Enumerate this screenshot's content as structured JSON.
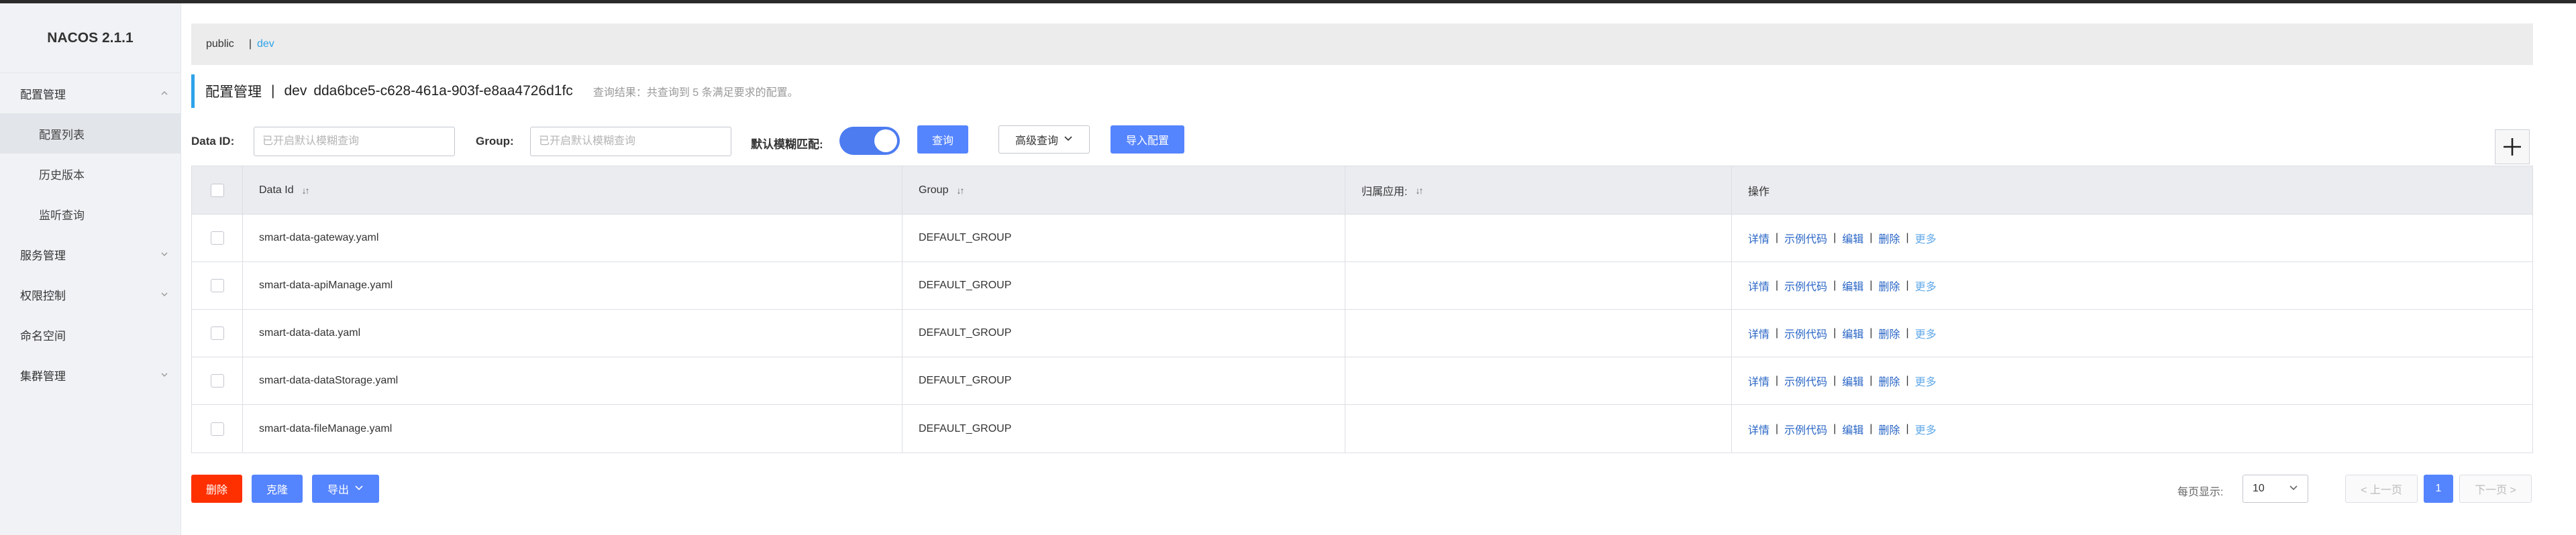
{
  "app": {
    "title": "NACOS 2.1.1"
  },
  "sidebar": {
    "items": [
      {
        "label": "配置管理",
        "expanded": true,
        "icon": "chevron-up-icon"
      },
      {
        "label": "配置列表",
        "sub": true,
        "active": true
      },
      {
        "label": "历史版本",
        "sub": true
      },
      {
        "label": "监听查询",
        "sub": true
      },
      {
        "label": "服务管理",
        "icon": "chevron-down-icon"
      },
      {
        "label": "权限控制",
        "icon": "chevron-down-icon"
      },
      {
        "label": "命名空间"
      },
      {
        "label": "集群管理",
        "icon": "chevron-down-icon"
      }
    ]
  },
  "namespaces": {
    "first": "public",
    "separator": "|",
    "second": "dev"
  },
  "header": {
    "title": "配置管理",
    "separator": "|",
    "namespace": "dev",
    "namespace_id": "dda6bce5-c628-461a-903f-e8aa4726d1fc",
    "result": "查询结果：共查询到 5 条满足要求的配置。"
  },
  "filters": {
    "data_id_label": "Data ID:",
    "data_id_placeholder": "已开启默认模糊查询",
    "group_label": "Group:",
    "group_placeholder": "已开启默认模糊查询",
    "fuzzy_label": "默认模糊匹配:",
    "fuzzy_on": true,
    "query_button": "查询",
    "advanced_button": "高级查询",
    "import_button": "导入配置"
  },
  "table": {
    "headers": {
      "data_id": "Data Id",
      "group": "Group",
      "app": "归属应用:",
      "ops": "操作"
    },
    "ops": {
      "detail": "详情",
      "sample": "示例代码",
      "edit": "编辑",
      "delete": "删除",
      "more": "更多",
      "sep": "|"
    },
    "rows": [
      {
        "data_id": "smart-data-gateway.yaml",
        "group": "DEFAULT_GROUP",
        "app": ""
      },
      {
        "data_id": "smart-data-apiManage.yaml",
        "group": "DEFAULT_GROUP",
        "app": ""
      },
      {
        "data_id": "smart-data-data.yaml",
        "group": "DEFAULT_GROUP",
        "app": ""
      },
      {
        "data_id": "smart-data-dataStorage.yaml",
        "group": "DEFAULT_GROUP",
        "app": ""
      },
      {
        "data_id": "smart-data-fileManage.yaml",
        "group": "DEFAULT_GROUP",
        "app": ""
      }
    ]
  },
  "footer": {
    "delete_button": "删除",
    "clone_button": "克隆",
    "export_button": "导出",
    "page_size_label": "每页显示:",
    "page_size": "10",
    "prev": "< 上一页",
    "page": "1",
    "next": "下一页 >"
  },
  "colors": {
    "primary": "#5584ff",
    "danger": "#ff3000",
    "accent": "#2fa2ea"
  }
}
